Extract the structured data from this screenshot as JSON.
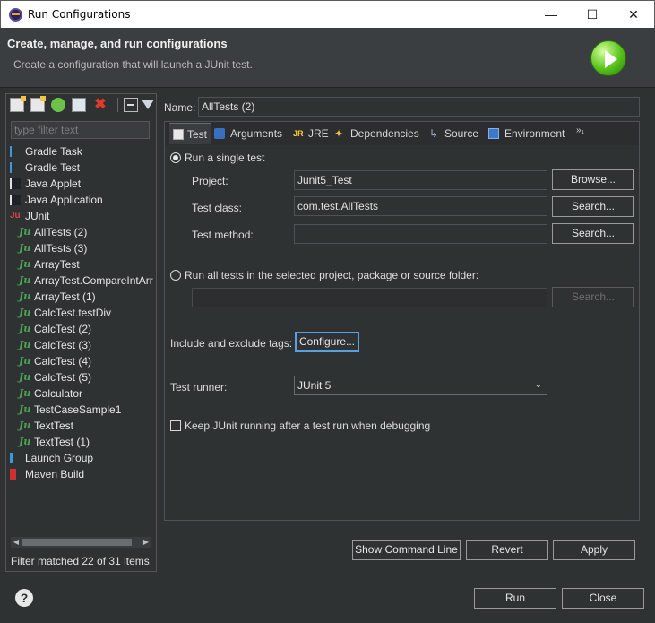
{
  "window": {
    "title": "Run Configurations",
    "minimize": "—",
    "maximize": "☐",
    "close": "✕"
  },
  "header": {
    "title": "Create, manage, and run configurations",
    "subtitle": "Create a configuration that will launch a JUnit test."
  },
  "left": {
    "filter_placeholder": "type filter text",
    "delete_glyph": "✖",
    "tree": [
      {
        "label": "Gradle Task",
        "icon": "gradle"
      },
      {
        "label": "Gradle Test",
        "icon": "gradle"
      },
      {
        "label": "Java Applet",
        "icon": "java"
      },
      {
        "label": "Java Application",
        "icon": "java"
      },
      {
        "label": "JUnit",
        "icon": "junit"
      },
      {
        "label": "AllTests (2)",
        "icon": "ju"
      },
      {
        "label": "AllTests (3)",
        "icon": "ju"
      },
      {
        "label": "ArrayTest",
        "icon": "ju"
      },
      {
        "label": "ArrayTest.CompareIntArr",
        "icon": "ju"
      },
      {
        "label": "ArrayTest (1)",
        "icon": "ju"
      },
      {
        "label": "CalcTest.testDiv",
        "icon": "ju"
      },
      {
        "label": "CalcTest (2)",
        "icon": "ju"
      },
      {
        "label": "CalcTest (3)",
        "icon": "ju"
      },
      {
        "label": "CalcTest (4)",
        "icon": "ju"
      },
      {
        "label": "CalcTest (5)",
        "icon": "ju"
      },
      {
        "label": "Calculator",
        "icon": "ju"
      },
      {
        "label": "TestCaseSample1",
        "icon": "ju"
      },
      {
        "label": "TextTest",
        "icon": "ju"
      },
      {
        "label": "TextTest (1)",
        "icon": "ju"
      },
      {
        "label": "Launch Group",
        "icon": "launch"
      },
      {
        "label": "Maven Build",
        "icon": "maven"
      }
    ],
    "status": "Filter matched 22 of 31 items",
    "scroll_left": "◀",
    "scroll_right": "▶"
  },
  "config": {
    "name_label": "Name:",
    "name_value": "AllTests (2)",
    "tabs": [
      {
        "label": "Test",
        "icon": "test-icon"
      },
      {
        "label": "Arguments",
        "icon": "arguments-icon"
      },
      {
        "label": "JRE",
        "icon": "jre-icon"
      },
      {
        "label": "Dependencies",
        "icon": "dependencies-icon"
      },
      {
        "label": "Source",
        "icon": "source-icon"
      },
      {
        "label": "Environment",
        "icon": "environment-icon"
      }
    ],
    "more_tabs": "»₁",
    "jre_glyph": "JR",
    "deps_glyph": "✦",
    "src_glyph": "↳",
    "single_test_label": "Run a single test",
    "project_label": "Project:",
    "project_value": "Junit5_Test",
    "browse_label": "Browse...",
    "test_class_label": "Test class:",
    "test_class_value": "com.test.AllTests",
    "search_label": "Search...",
    "test_method_label": "Test method:",
    "test_method_value": "",
    "all_tests_label": "Run all tests in the selected project, package or source folder:",
    "tags_label": "Include and exclude tags:",
    "configure_label": "Configure...",
    "runner_label": "Test runner:",
    "runner_value": "JUnit 5",
    "runner_chevron": "⌄",
    "keep_running_label": "Keep JUnit running after a test run when debugging",
    "show_cmd_label": "Show Command Line",
    "revert_label": "Revert",
    "apply_label": "Apply"
  },
  "footer": {
    "help": "?",
    "run_label": "Run",
    "close_label": "Close"
  }
}
